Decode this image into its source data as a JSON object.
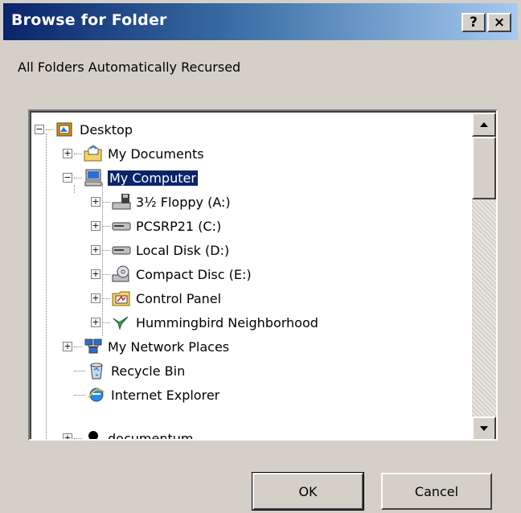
{
  "window": {
    "title": "Browse for Folder",
    "help_label": "?",
    "close_label": "×"
  },
  "instructions": "All Folders Automatically Recursed",
  "tree": {
    "items": [
      {
        "label": "Desktop",
        "icon": "desktop-icon",
        "expander": "−"
      },
      {
        "label": "My Documents",
        "icon": "my-documents-icon",
        "expander": "+"
      },
      {
        "label": "My Computer",
        "icon": "my-computer-icon",
        "expander": "−",
        "selected": true
      },
      {
        "label": "3½ Floppy (A:)",
        "icon": "floppy-drive-icon",
        "expander": "+"
      },
      {
        "label": "PCSRP21 (C:)",
        "icon": "hard-drive-icon",
        "expander": "+"
      },
      {
        "label": "Local Disk (D:)",
        "icon": "hard-drive-icon",
        "expander": "+"
      },
      {
        "label": "Compact Disc (E:)",
        "icon": "cd-drive-icon",
        "expander": "+"
      },
      {
        "label": "Control Panel",
        "icon": "control-panel-icon",
        "expander": "+"
      },
      {
        "label": "Hummingbird Neighborhood",
        "icon": "hummingbird-icon",
        "expander": "+"
      },
      {
        "label": "My Network Places",
        "icon": "network-places-icon",
        "expander": "+"
      },
      {
        "label": "Recycle Bin",
        "icon": "recycle-bin-icon",
        "expander": ""
      },
      {
        "label": "Internet Explorer",
        "icon": "internet-explorer-icon",
        "expander": ""
      },
      {
        "label": "documentum",
        "icon": "documentum-icon",
        "expander": "+"
      }
    ]
  },
  "buttons": {
    "ok": "OK",
    "cancel": "Cancel"
  },
  "colors": {
    "title_bar_start": "#0a246a",
    "title_bar_end": "#a6caf0",
    "face": "#d4d0c8",
    "selection": "#0a246a"
  }
}
